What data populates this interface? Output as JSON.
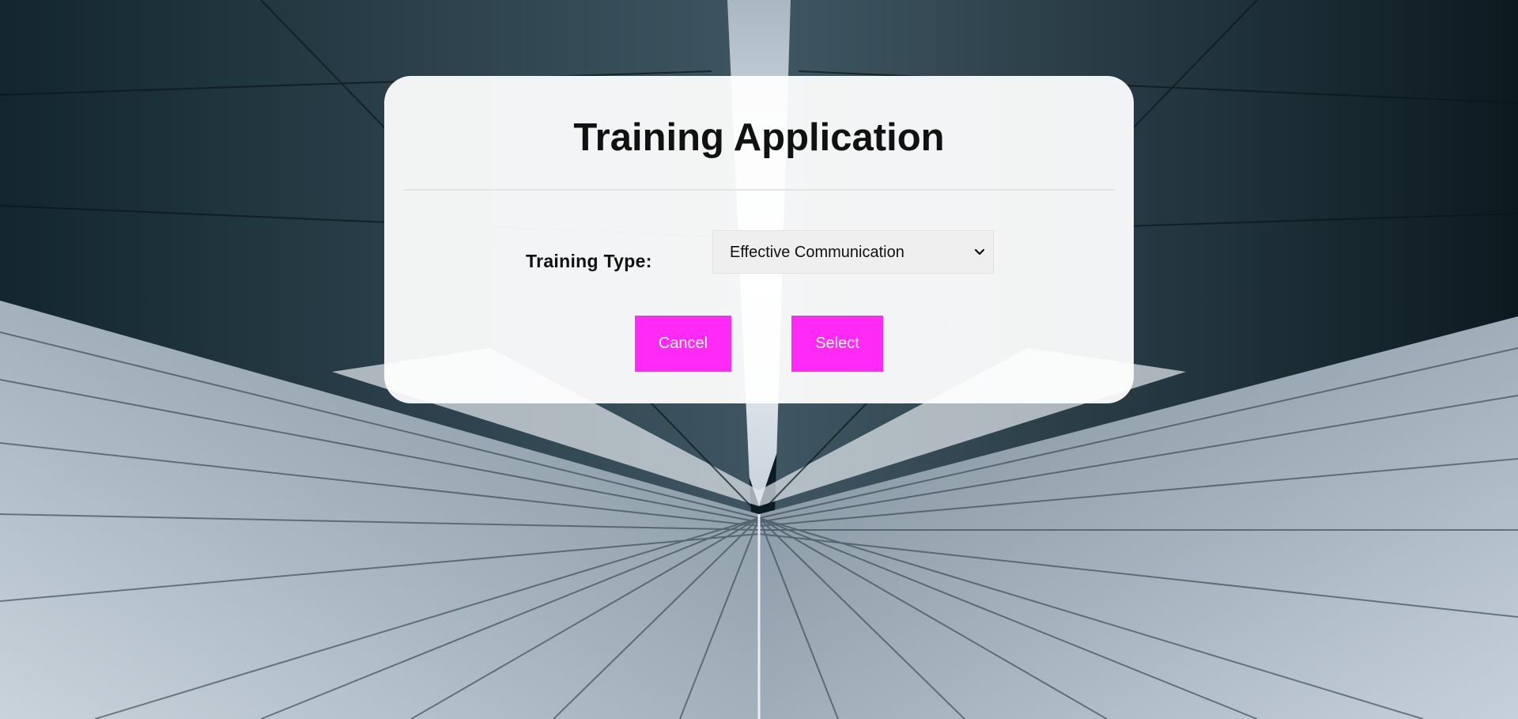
{
  "form": {
    "title": "Training Application",
    "training_type_label": "Training Type:",
    "training_type_selected": "Effective Communication"
  },
  "buttons": {
    "cancel_label": "Cancel",
    "select_label": "Select"
  },
  "colors": {
    "button_bg": "#ff2af5",
    "button_text": "#ffffff",
    "card_bg": "#ffffff",
    "select_bg": "#efefef"
  },
  "icons": {
    "select_chevron": "chevron-down-icon"
  }
}
